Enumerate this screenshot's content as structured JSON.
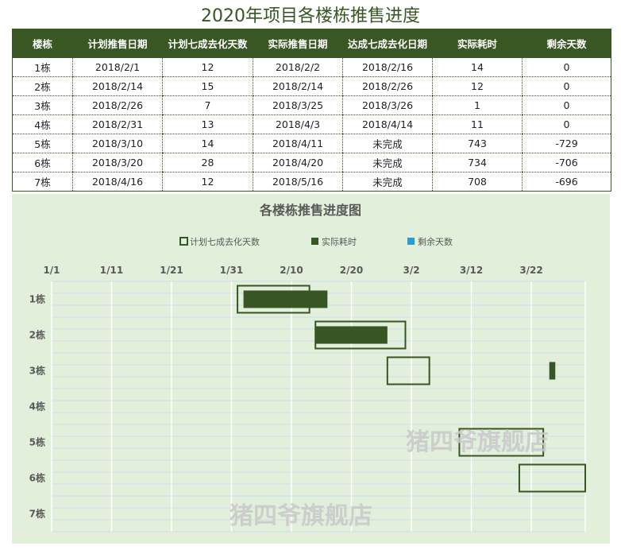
{
  "title": "2020年项目各楼栋推售进度",
  "table": {
    "headers": [
      "楼栋",
      "计划推售日期",
      "计划七成去化天数",
      "实际推售日期",
      "达成七成去化日期",
      "实际耗时",
      "剩余天数"
    ],
    "rows": [
      [
        "1栋",
        "2018/2/1",
        "12",
        "2018/2/2",
        "2018/2/16",
        "14",
        "0"
      ],
      [
        "2栋",
        "2018/2/14",
        "15",
        "2018/2/14",
        "2018/2/26",
        "12",
        "0"
      ],
      [
        "3栋",
        "2018/2/26",
        "7",
        "2018/3/25",
        "2018/3/26",
        "1",
        "0"
      ],
      [
        "4栋",
        "2018/2/31",
        "13",
        "2018/4/3",
        "2018/4/14",
        "11",
        "0"
      ],
      [
        "5栋",
        "2018/3/10",
        "14",
        "2018/4/11",
        "未完成",
        "743",
        "-729"
      ],
      [
        "6栋",
        "2018/3/20",
        "28",
        "2018/4/20",
        "未完成",
        "734",
        "-706"
      ],
      [
        "7栋",
        "2018/4/16",
        "12",
        "2018/5/16",
        "未完成",
        "708",
        "-696"
      ]
    ]
  },
  "chart_data": {
    "type": "bar",
    "orientation": "horizontal-gantt",
    "title": "各楼栋推售进度图",
    "categories": [
      "1栋",
      "2栋",
      "3栋",
      "4栋",
      "5栋",
      "6栋",
      "7栋"
    ],
    "x_tick_labels": [
      "1/1",
      "1/11",
      "1/21",
      "1/31",
      "2/10",
      "2/20",
      "3/2",
      "3/12",
      "3/22"
    ],
    "x_ticks": [
      "2018-01-01",
      "2018-01-11",
      "2018-01-21",
      "2018-01-31",
      "2018-02-10",
      "2018-02-20",
      "2018-03-02",
      "2018-03-12",
      "2018-03-22"
    ],
    "xlim": [
      "2018-01-01",
      "2018-03-31"
    ],
    "series": [
      {
        "name": "计划七成去化天数",
        "style": "outline",
        "start": [
          "2018-02-01",
          "2018-02-14",
          "2018-02-26",
          null,
          "2018-03-10",
          "2018-03-20",
          null
        ],
        "values": [
          12,
          15,
          7,
          13,
          14,
          28,
          12
        ]
      },
      {
        "name": "实际耗时",
        "style": "filled",
        "start": [
          "2018-02-02",
          "2018-02-14",
          "2018-03-25",
          null,
          null,
          null,
          null
        ],
        "values": [
          14,
          12,
          1,
          11,
          743,
          734,
          708
        ]
      },
      {
        "name": "剩余天数",
        "style": "filled",
        "values": [
          0,
          0,
          0,
          0,
          -729,
          -706,
          -696
        ]
      }
    ],
    "legend": "top",
    "colors": {
      "plan": "#375623",
      "actual": "#375623",
      "remain": "#2e9bd6",
      "plot_bg": "#e2efda"
    },
    "grid": true
  },
  "watermark": "猪四爷旗舰店"
}
